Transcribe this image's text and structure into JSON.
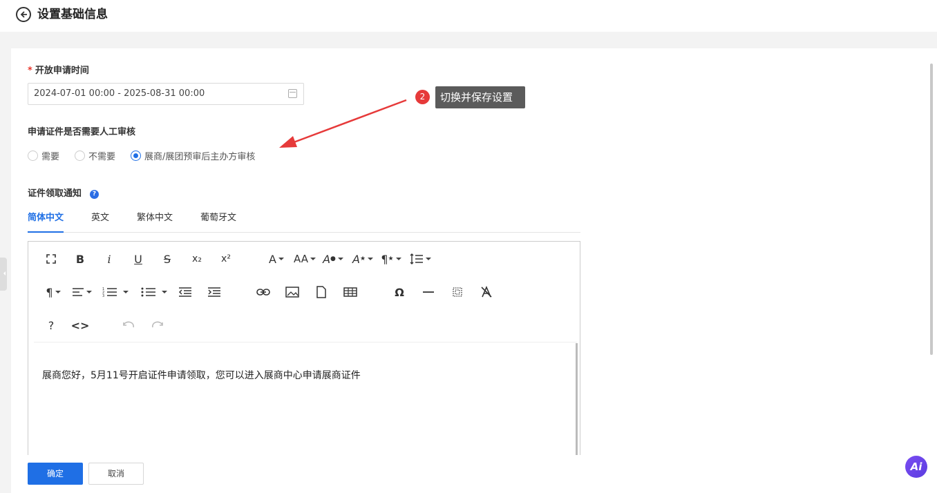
{
  "header": {
    "title": "设置基础信息",
    "back_icon": "arrow-left-circle-icon"
  },
  "form": {
    "open_time": {
      "required_mark": "*",
      "label": "开放申请时间",
      "value": "2024-07-01 00:00 - 2025-08-31 00:00",
      "icon": "calendar-icon"
    },
    "review": {
      "label": "申请证件是否需要人工审核",
      "options": [
        "需要",
        "不需要",
        "展商/展团预审后主办方审核"
      ],
      "selected": "展商/展团预审后主办方审核"
    },
    "notice": {
      "label": "证件领取通知",
      "help_icon": "?",
      "tabs": [
        "简体中文",
        "英文",
        "繁体中文",
        "葡萄牙文"
      ],
      "active_tab": "简体中文",
      "content": "展商您好，5月11号开启证件申请领取，您可以进入展商中心申请展商证件"
    }
  },
  "toolbar": {
    "row1": [
      "fullscreen-icon",
      "bold-icon",
      "italic-icon",
      "underline-icon",
      "strikethrough-icon",
      "subscript-icon",
      "superscript-icon",
      "font-family-icon",
      "font-size-icon",
      "text-color-icon",
      "background-color-icon",
      "inline-style-icon",
      "line-height-icon"
    ],
    "row2": [
      "paragraph-format-icon",
      "align-icon",
      "ordered-list-icon",
      "unordered-list-icon",
      "outdent-icon",
      "indent-icon",
      "link-icon",
      "image-icon",
      "file-icon",
      "table-icon",
      "special-char-icon",
      "horizontal-line-icon",
      "select-all-icon",
      "clear-format-icon"
    ],
    "row3": [
      "help-icon",
      "code-view-icon",
      "undo-icon",
      "redo-icon"
    ],
    "glyphs": {
      "bold": "B",
      "italic": "i",
      "underline": "U",
      "strike": "S",
      "sub": "x₂",
      "sup": "x²",
      "font": "A",
      "size": "AA",
      "pilcrow": "¶",
      "omega": "Ω",
      "help": "?",
      "code": "<>"
    }
  },
  "annotation": {
    "badge": "2",
    "tooltip": "切换并保存设置"
  },
  "actions": {
    "confirm": "确定",
    "cancel": "取消"
  },
  "ai_button": {
    "label": "Ai"
  },
  "colors": {
    "primary": "#1f6fe5",
    "required": "#e8362c",
    "annotation_red": "#e63a3a",
    "ai_purple": "#6a45ea"
  }
}
